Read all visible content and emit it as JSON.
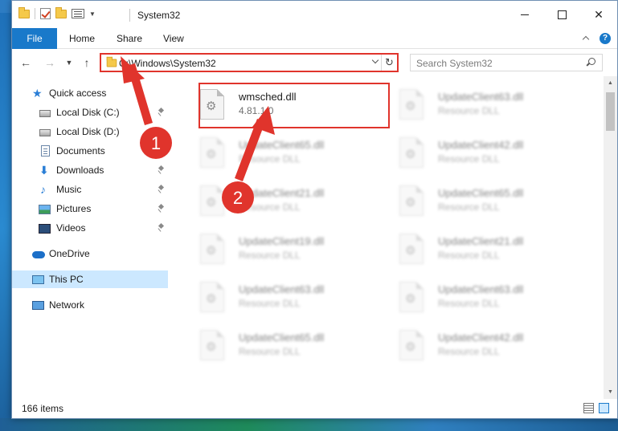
{
  "window": {
    "title": "System32",
    "controls": {
      "close": "✕"
    }
  },
  "ribbon": {
    "tabs": [
      "File",
      "Home",
      "Share",
      "View"
    ],
    "help": "?"
  },
  "nav": {
    "back": "←",
    "forward": "→",
    "recent": "▼",
    "up": "↑",
    "address": "C:\\Windows\\System32",
    "refresh": "↻",
    "search_placeholder": "Search System32"
  },
  "sidebar": {
    "items": [
      {
        "label": "Quick access",
        "icon": "star-icon",
        "pinned": false
      },
      {
        "label": "Local Disk (C:)",
        "icon": "drive-icon",
        "pinned": true
      },
      {
        "label": "Local Disk (D:)",
        "icon": "drive-icon",
        "pinned": false
      },
      {
        "label": "Documents",
        "icon": "documents-icon",
        "pinned": true
      },
      {
        "label": "Downloads",
        "icon": "download-icon",
        "pinned": true
      },
      {
        "label": "Music",
        "icon": "music-icon",
        "pinned": true
      },
      {
        "label": "Pictures",
        "icon": "pictures-icon",
        "pinned": true
      },
      {
        "label": "Videos",
        "icon": "videos-icon",
        "pinned": true
      },
      {
        "label": "OneDrive",
        "icon": "onedrive-icon",
        "pinned": false
      },
      {
        "label": "This PC",
        "icon": "pc-icon",
        "pinned": false,
        "selected": true
      },
      {
        "label": "Network",
        "icon": "network-icon",
        "pinned": false
      }
    ]
  },
  "files": {
    "featured": {
      "name": "wmsched.dll",
      "sub": "4.81.1.0"
    },
    "col1": [
      {
        "name": "UpdateClient65.dll",
        "sub": "Resource DLL"
      },
      {
        "name": "UpdateClient21.dll",
        "sub": "Resource DLL"
      },
      {
        "name": "UpdateClient19.dll",
        "sub": "Resource DLL"
      },
      {
        "name": "UpdateClient63.dll",
        "sub": "Resource DLL"
      },
      {
        "name": "UpdateClient65.dll",
        "sub": "Resource DLL"
      }
    ],
    "col2": [
      {
        "name": "UpdateClient63.dll",
        "sub": "Resource DLL"
      },
      {
        "name": "UpdateClient42.dll",
        "sub": "Resource DLL"
      },
      {
        "name": "UpdateClient65.dll",
        "sub": "Resource DLL"
      },
      {
        "name": "UpdateClient21.dll",
        "sub": "Resource DLL"
      },
      {
        "name": "UpdateClient63.dll",
        "sub": "Resource DLL"
      },
      {
        "name": "UpdateClient42.dll",
        "sub": "Resource DLL"
      }
    ]
  },
  "status": {
    "item_count": "166 items"
  },
  "annotations": {
    "step1": "1",
    "step2": "2",
    "color": "#e0342c"
  },
  "colors": {
    "accent": "#1979ca",
    "selection": "#cce8ff",
    "highlight": "#e0342c"
  }
}
